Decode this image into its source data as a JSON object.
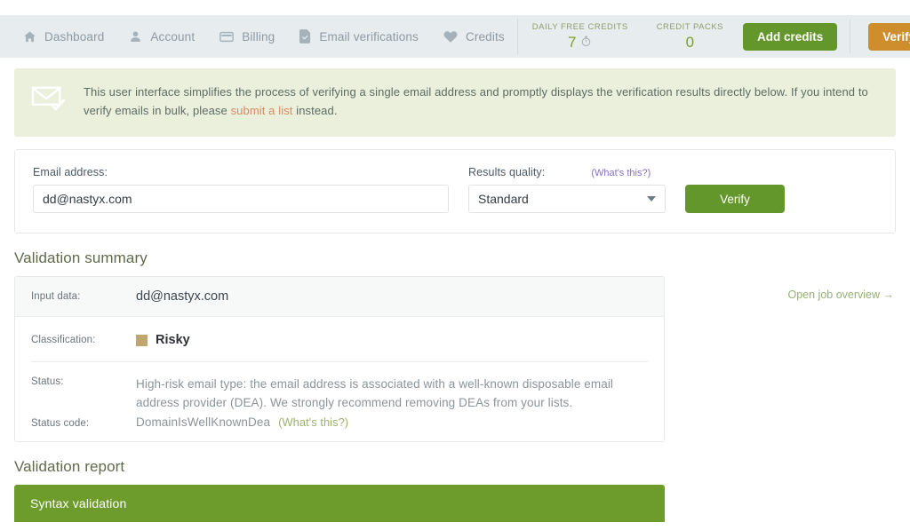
{
  "topnav": {
    "items": [
      {
        "label": "Dashboard",
        "icon": "home-icon"
      },
      {
        "label": "Account",
        "icon": "user-icon"
      },
      {
        "label": "Billing",
        "icon": "credit-card-icon"
      },
      {
        "label": "Email verifications",
        "icon": "document-check-icon"
      },
      {
        "label": "Credits",
        "icon": "heart-icon"
      }
    ],
    "daily_free_credits_label": "DAILY FREE CREDITS",
    "daily_free_credits_value": "7",
    "credit_packs_label": "CREDIT PACKS",
    "credit_packs_value": "0",
    "add_credits_label": "Add credits",
    "verify_emails_label": "Verify emails"
  },
  "banner": {
    "text_before": "This user interface simplifies the process of verifying a single email address and promptly displays the verification results directly below. If you intend to verify emails in bulk, please ",
    "link": "submit a list",
    "text_after": " instead.",
    "icon": "envelope-check-icon"
  },
  "form": {
    "email_label": "Email address:",
    "email_value": "dd@nastyx.com",
    "email_placeholder": "Email address",
    "quality_label": "Results quality:",
    "quality_help": "(What's this?)",
    "quality_value": "Standard",
    "verify_button": "Verify"
  },
  "summary": {
    "title": "Validation summary",
    "input_key": "Input data:",
    "input_value": "dd@nastyx.com",
    "classification_key": "Classification:",
    "classification_value": "Risky",
    "classification_color": "#bfa671",
    "status_key": "Status:",
    "status_value": "High-risk email type: the email address is associated with a well-known disposable email address provider (DEA). We strongly recommend removing DEAs from your lists.",
    "status_code_key": "Status code:",
    "status_code_value": "DomainIsWellKnownDea",
    "status_code_help": "(What's this?)",
    "side_link": "Open job overview →"
  },
  "report": {
    "title": "Validation report",
    "syntax_section": "Syntax validation"
  },
  "colors": {
    "green": "#64972b",
    "orange": "#cf8e2e",
    "nav_bg": "#e7ecee",
    "banner_bg": "#eaf0dc",
    "risky": "#bfa671"
  }
}
